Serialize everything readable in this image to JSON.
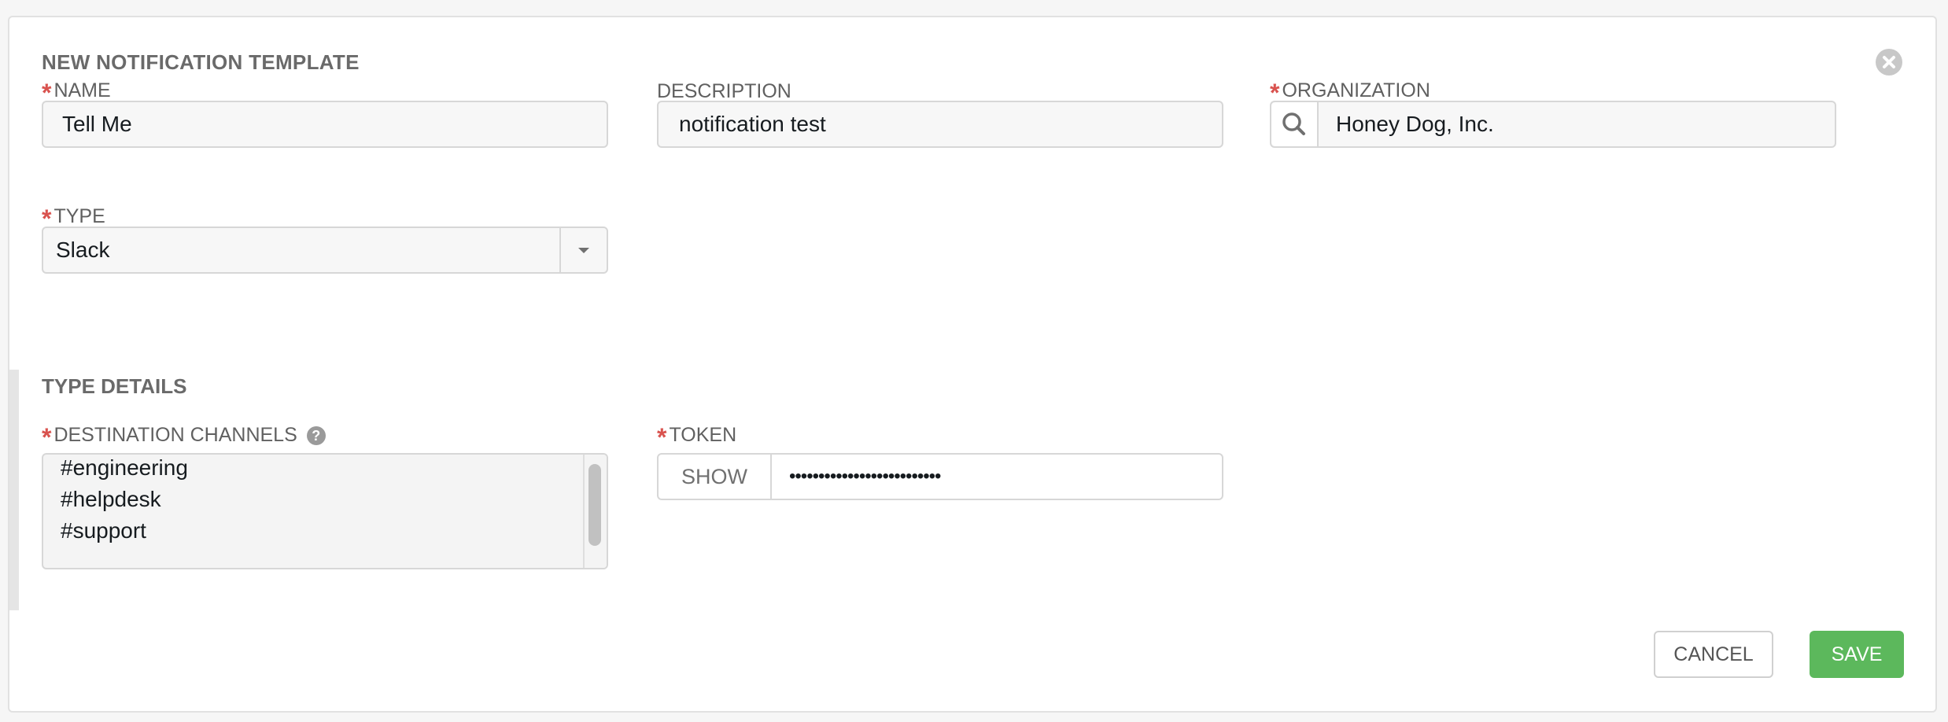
{
  "dialog": {
    "title": "NEW NOTIFICATION TEMPLATE",
    "close_icon": "close-circle-icon"
  },
  "form": {
    "name": {
      "label": "NAME",
      "required": true,
      "value": "Tell Me"
    },
    "description": {
      "label": "DESCRIPTION",
      "required": false,
      "value": "notification test"
    },
    "organization": {
      "label": "ORGANIZATION",
      "required": true,
      "value": "Honey Dog, Inc.",
      "icon": "search-icon"
    },
    "type": {
      "label": "TYPE",
      "required": true,
      "value": "Slack",
      "icon": "caret-down-icon"
    }
  },
  "type_details": {
    "title": "TYPE DETAILS",
    "destination_channels": {
      "label": "DESTINATION CHANNELS",
      "required": true,
      "help_icon": "question-circle-icon",
      "help_glyph": "?",
      "values": [
        "#engineering",
        "#helpdesk",
        "#support"
      ]
    },
    "token": {
      "label": "TOKEN",
      "required": true,
      "show_label": "SHOW",
      "masked_value": "••••••••••••••••••••••••••"
    }
  },
  "actions": {
    "cancel_label": "CANCEL",
    "save_label": "SAVE"
  },
  "colors": {
    "required_asterisk": "#d9534f",
    "save_button": "#5cb85c",
    "page_background": "#f6f6f6"
  }
}
